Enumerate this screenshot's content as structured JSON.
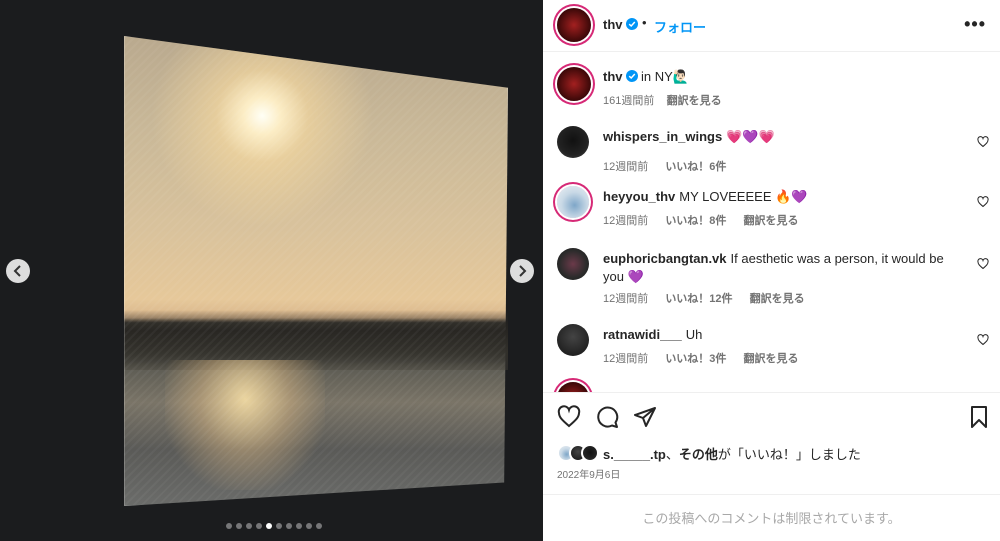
{
  "post": {
    "username": "thv",
    "follow_label": "フォロー",
    "separator": "•",
    "more_label": "•••",
    "caption_location": "in NY🙋🏻‍♂️",
    "caption_time": "161週間前",
    "caption_translate": "翻訳を見る",
    "carousel": {
      "total": 10,
      "active_index": 5
    }
  },
  "comments": [
    {
      "username": "whispers_in_wings",
      "text": "💗💜💗",
      "time": "12週間前",
      "likes": "いいね！6件",
      "translate": ""
    },
    {
      "username": "heyyou_thv",
      "text": "MY LOVEEEEE 🔥💜",
      "time": "12週間前",
      "likes": "いいね！8件",
      "translate": "翻訳を見る"
    },
    {
      "username": "euphoricbangtan.vk",
      "text": "If aesthetic was a person, it would be you 💜",
      "time": "12週間前",
      "likes": "いいね！12件",
      "translate": "翻訳を見る"
    },
    {
      "username": "ratnawidi___",
      "text": "Uh",
      "time": "12週間前",
      "likes": "いいね！3件",
      "translate": "翻訳を見る"
    }
  ],
  "likes_summary": {
    "user": "s._____.tp",
    "connector": "、",
    "others": "その他",
    "suffix": "が「いいね！」しました"
  },
  "date": "2022年9月6日",
  "comments_restricted": "この投稿へのコメントは制限されています。",
  "colors": {
    "accent": "#0095f6",
    "muted": "#737373"
  }
}
